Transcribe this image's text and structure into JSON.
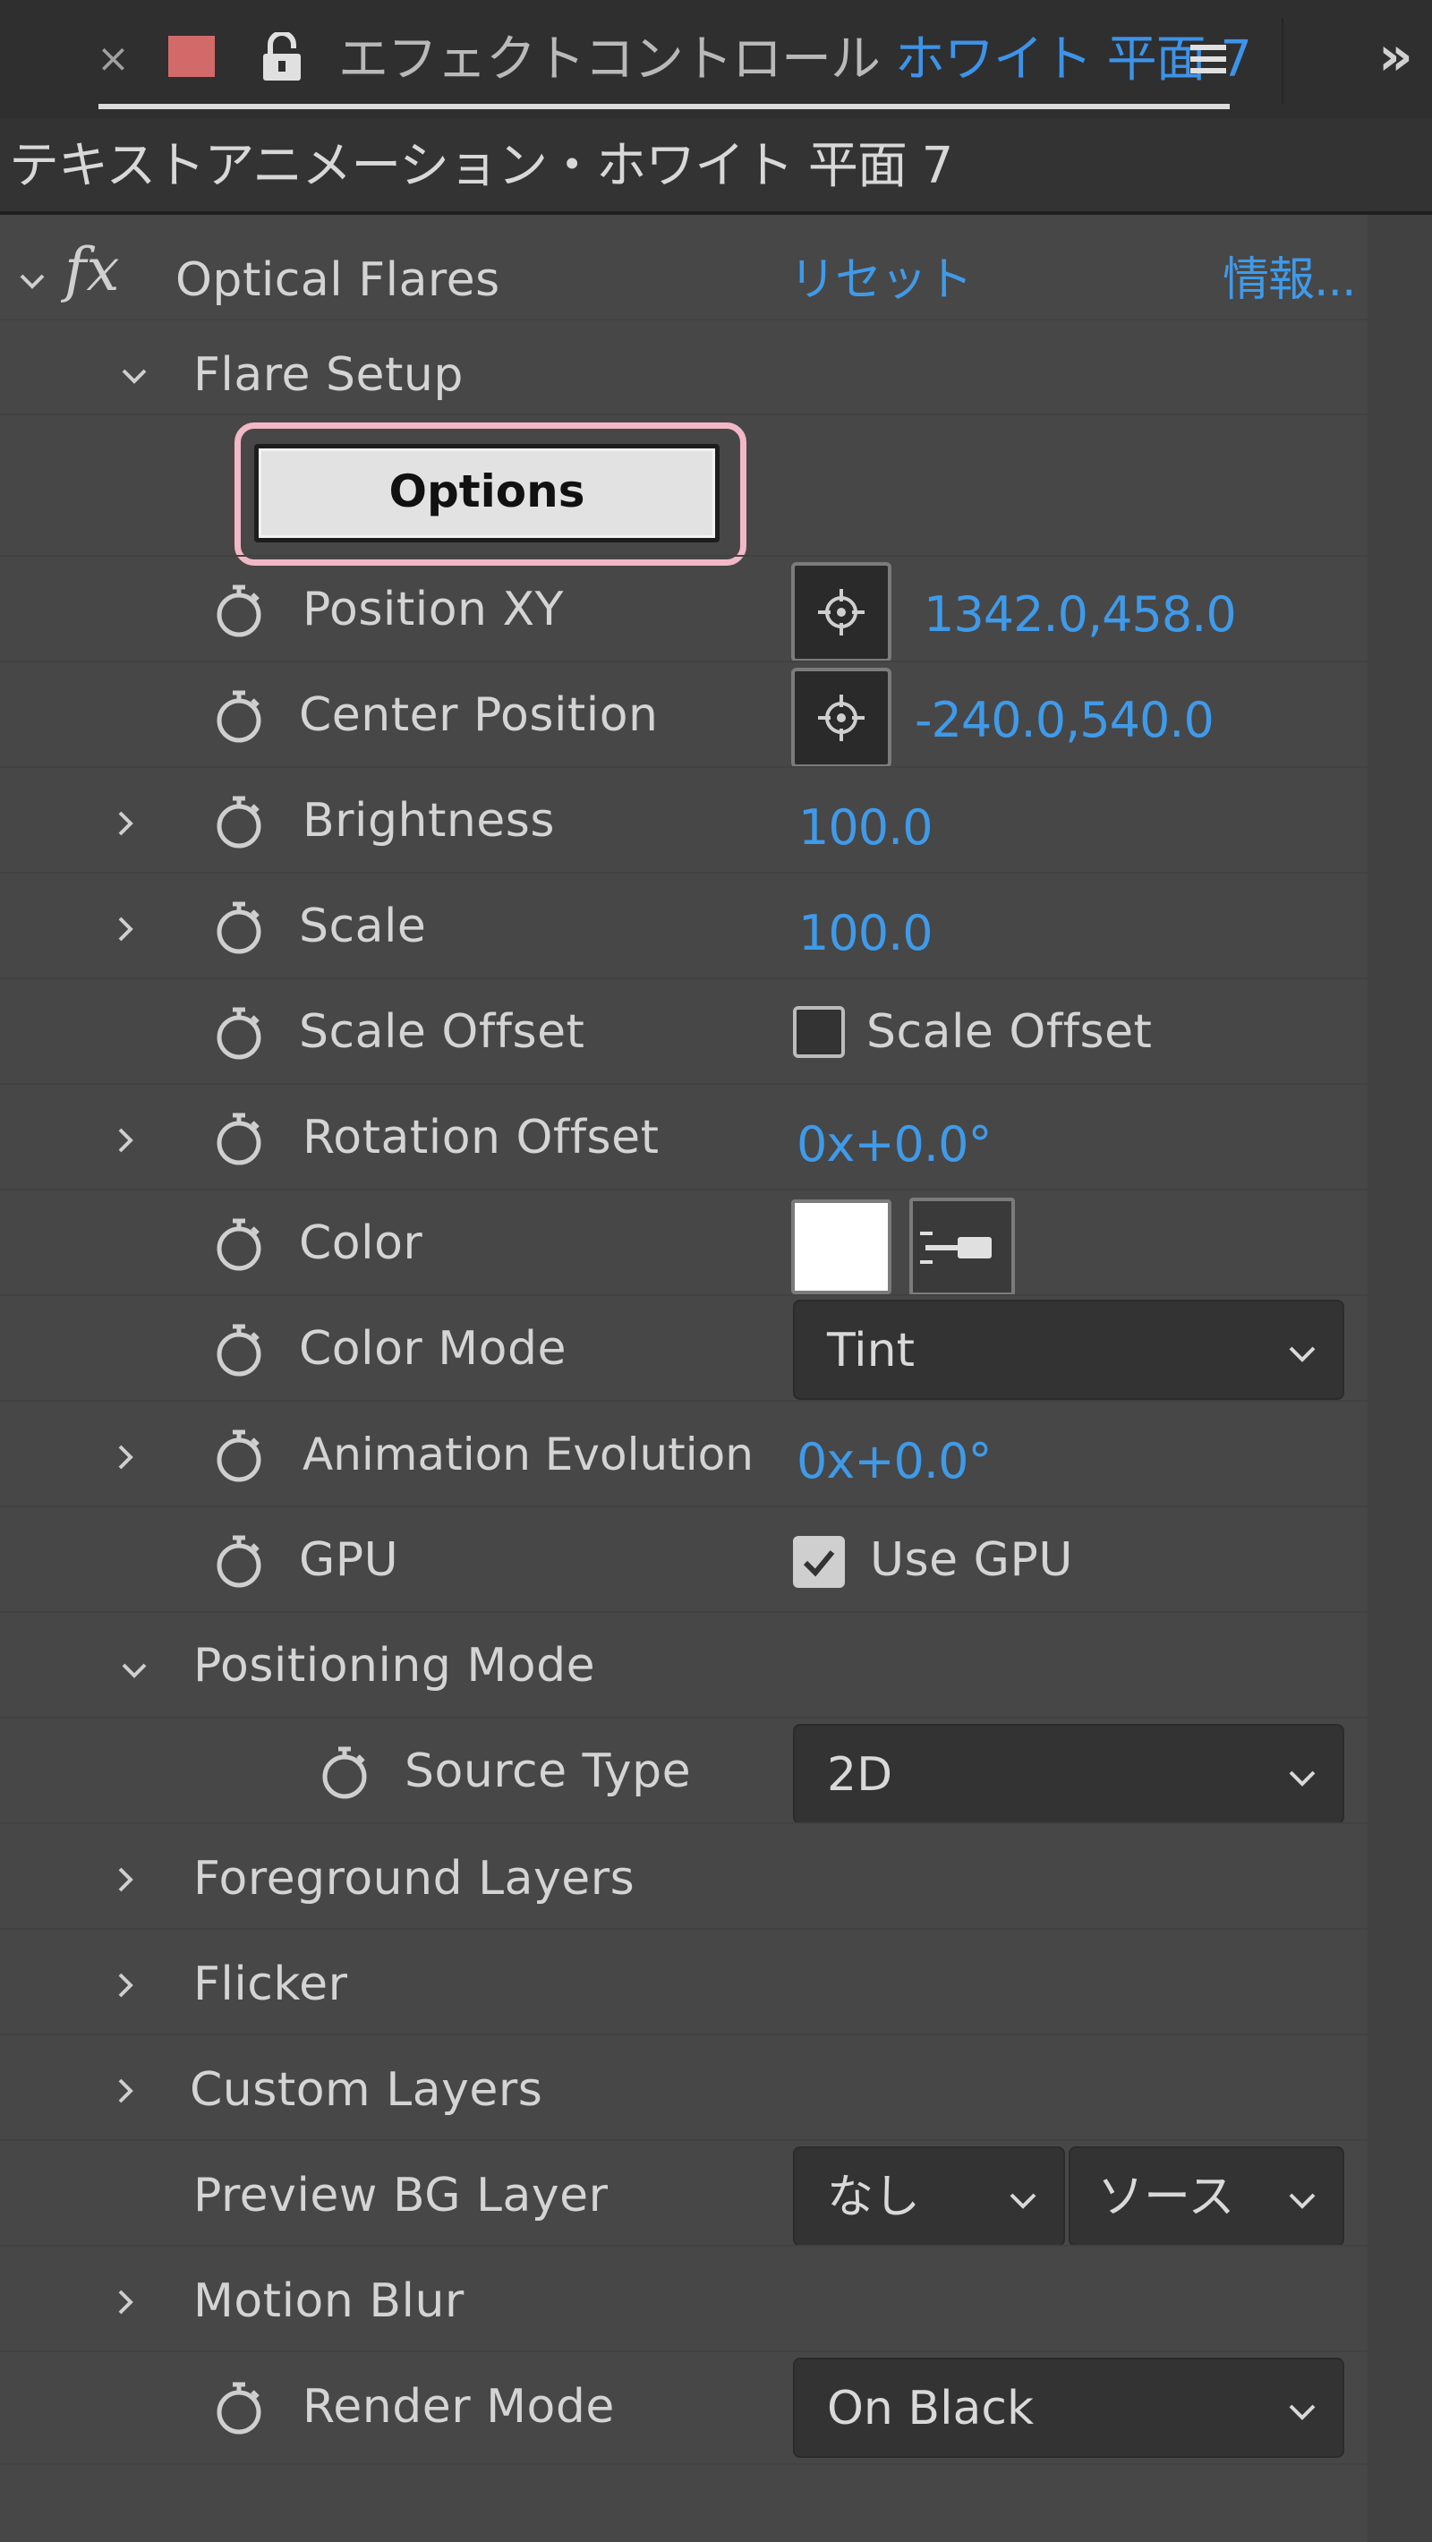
{
  "tab": {
    "close_glyph": "×",
    "title_prefix": "エフェクトコントロール ",
    "title_layer": "ホワイト 平面 7",
    "overflow_glyph": "»",
    "swatch_color": "#d26a6a"
  },
  "subheader": {
    "text": "テキストアニメーション・ホワイト 平面 7"
  },
  "effect": {
    "fx_glyph": "fx",
    "name": "Optical Flares",
    "reset_label": "リセット",
    "about_label": "情報..."
  },
  "flare_setup": {
    "label": "Flare Setup",
    "options_button": "Options",
    "position_xy": {
      "label": "Position XY",
      "value": "1342.0,458.0"
    },
    "center_position": {
      "label": "Center Position",
      "value": "-240.0,540.0"
    },
    "brightness": {
      "label": "Brightness",
      "value": "100.0"
    },
    "scale": {
      "label": "Scale",
      "value": "100.0"
    },
    "scale_offset": {
      "label": "Scale Offset",
      "checkbox_label": "Scale Offset",
      "checked": false
    },
    "rotation_offset": {
      "label": "Rotation Offset",
      "value": "0x+0.0°"
    },
    "color": {
      "label": "Color",
      "value_color": "#ffffff"
    },
    "color_mode": {
      "label": "Color Mode",
      "value": "Tint"
    },
    "animation_evolution": {
      "label": "Animation Evolution",
      "value": "0x+0.0°"
    },
    "gpu": {
      "label": "GPU",
      "checkbox_label": "Use GPU",
      "checked": true
    }
  },
  "positioning_mode": {
    "label": "Positioning Mode",
    "source_type": {
      "label": "Source Type",
      "value": "2D"
    }
  },
  "foreground_layers": {
    "label": "Foreground Layers"
  },
  "flicker": {
    "label": "Flicker"
  },
  "custom_layers": {
    "label": "Custom Layers"
  },
  "preview_bg_layer": {
    "label": "Preview BG Layer",
    "layer_value": "なし",
    "source_value": "ソース"
  },
  "motion_blur": {
    "label": "Motion Blur"
  },
  "render_mode": {
    "label": "Render Mode",
    "value": "On Black"
  },
  "colors": {
    "accent_blue": "#3f9ae9",
    "panel_bg": "#474747",
    "highlight_pink": "#f2b8c7"
  }
}
